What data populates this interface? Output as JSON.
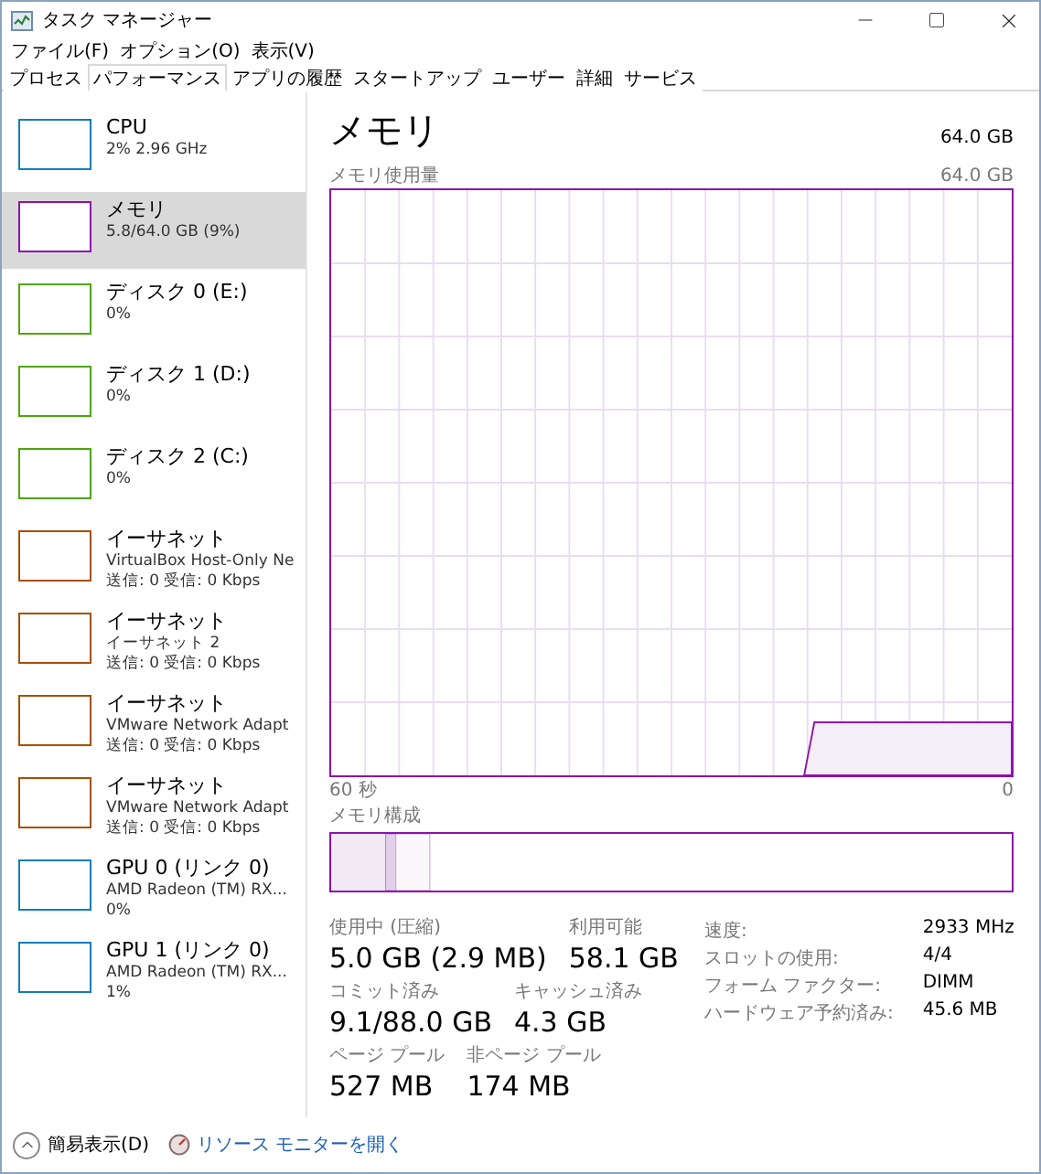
{
  "window": {
    "title": "タスク マネージャー"
  },
  "menu": [
    "ファイル(F)",
    "オプション(O)",
    "表示(V)"
  ],
  "tabs": [
    {
      "label": "プロセス",
      "selected": false
    },
    {
      "label": "パフォーマンス",
      "selected": true
    },
    {
      "label": "アプリの履歴",
      "selected": false
    },
    {
      "label": "スタートアップ",
      "selected": false
    },
    {
      "label": "ユーザー",
      "selected": false
    },
    {
      "label": "詳細",
      "selected": false
    },
    {
      "label": "サービス",
      "selected": false
    }
  ],
  "sidebar": {
    "items": [
      {
        "title": "CPU",
        "lines": [
          "2% 2.96 GHz"
        ],
        "color": "#117dbb",
        "selected": false
      },
      {
        "title": "メモリ",
        "lines": [
          "5.8/64.0 GB (9%)"
        ],
        "color": "#8b12ae",
        "selected": true
      },
      {
        "title": "ディスク 0 (E:)",
        "lines": [
          "0%"
        ],
        "color": "#4da60c",
        "selected": false
      },
      {
        "title": "ディスク 1 (D:)",
        "lines": [
          "0%"
        ],
        "color": "#4da60c",
        "selected": false
      },
      {
        "title": "ディスク 2 (C:)",
        "lines": [
          "0%"
        ],
        "color": "#4da60c",
        "selected": false
      },
      {
        "title": "イーサネット",
        "lines": [
          "VirtualBox Host-Only Ne",
          "送信: 0 受信: 0 Kbps"
        ],
        "color": "#a74f01",
        "selected": false
      },
      {
        "title": "イーサネット",
        "lines": [
          "イーサネット 2",
          "送信: 0 受信: 0 Kbps"
        ],
        "color": "#a74f01",
        "selected": false
      },
      {
        "title": "イーサネット",
        "lines": [
          "VMware Network Adapt",
          "送信: 0 受信: 0 Kbps"
        ],
        "color": "#a74f01",
        "selected": false
      },
      {
        "title": "イーサネット",
        "lines": [
          "VMware Network Adapt",
          "送信: 0 受信: 0 Kbps"
        ],
        "color": "#a74f01",
        "selected": false
      },
      {
        "title": "GPU 0 (リンク 0)",
        "lines": [
          "AMD Radeon (TM) RX...",
          "0%"
        ],
        "color": "#117dbb",
        "selected": false
      },
      {
        "title": "GPU 1 (リンク 0)",
        "lines": [
          "AMD Radeon (TM) RX...",
          "1%"
        ],
        "color": "#117dbb",
        "selected": false
      }
    ]
  },
  "panel": {
    "title": "メモリ",
    "total": "64.0 GB",
    "usage_label": "メモリ使用量",
    "usage_max": "64.0 GB",
    "time_start": "60 秒",
    "time_end": "0",
    "composition_label": "メモリ構成"
  },
  "stats_rows": [
    [
      {
        "label": "使用中 (圧縮)",
        "value": "5.0 GB (2.9 MB)"
      },
      {
        "label": "利用可能",
        "value": "58.1 GB"
      }
    ],
    [
      {
        "label": "コミット済み",
        "value": "9.1/88.0 GB"
      },
      {
        "label": "キャッシュ済み",
        "value": "4.3 GB"
      }
    ],
    [
      {
        "label": "ページ プール",
        "value": "527 MB"
      },
      {
        "label": "非ページ プール",
        "value": "174 MB"
      }
    ]
  ],
  "details": [
    {
      "label": "速度:",
      "value": "2933 MHz"
    },
    {
      "label": "スロットの使用:",
      "value": "4/4"
    },
    {
      "label": "フォーム ファクター:",
      "value": "DIMM"
    },
    {
      "label": "ハードウェア予約済み:",
      "value": "45.6 MB"
    }
  ],
  "footer": {
    "fewer_details": "簡易表示(D)",
    "resource_monitor": "リソース モニターを開く"
  }
}
